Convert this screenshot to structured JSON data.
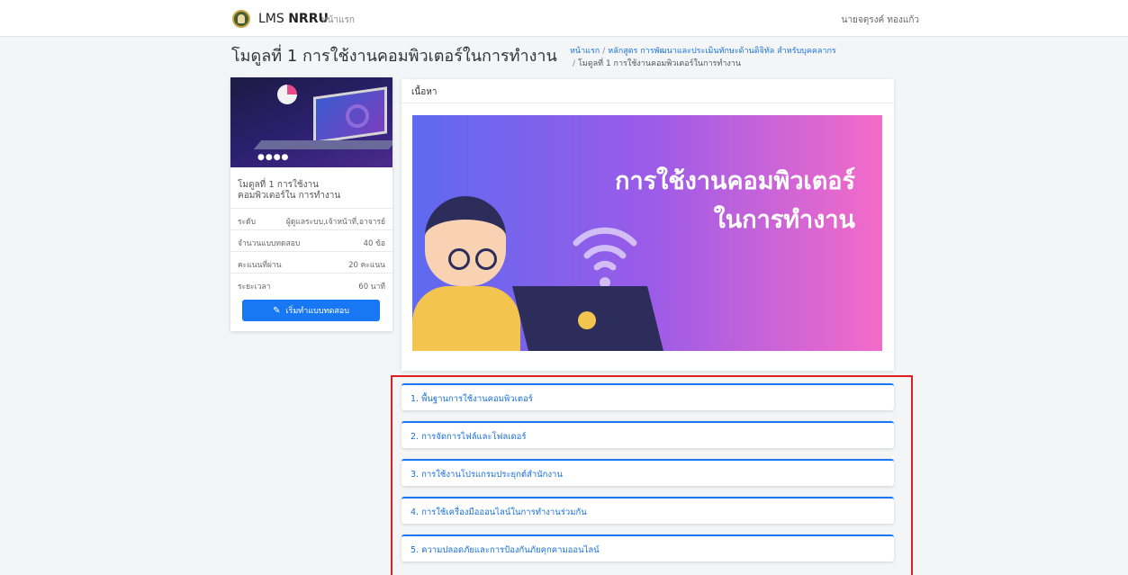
{
  "header": {
    "brand_prefix": "LMS ",
    "brand_bold": "NRRU",
    "nav_home": "หน้าแรก",
    "user_name": "นายจตุรงค์ ทองแก้ว"
  },
  "page": {
    "title": "โมดูลที่ 1 การใช้งานคอมพิวเตอร์ในการทำงาน",
    "breadcrumb": [
      "หน้าแรก",
      "หลักสูตร การพัฒนาและประเมินทักษะด้านดิจิทัล สำหรับบุคคลากร",
      "โมดูลที่ 1 การใช้งานคอมพิวเตอร์ในการทำงาน"
    ],
    "breadcrumb_sep": "/"
  },
  "sidebar": {
    "module_name": "โมดูลที่ 1 การใช้งานคอมพิวเตอร์ใน การทำงาน",
    "cover_social": "●●●●",
    "info": [
      {
        "label": "ระดับ",
        "value": "ผู้ดูแลระบบ,เจ้าหน้าที่,อาจารย์"
      },
      {
        "label": "จำนวนแบบทดสอบ",
        "value": "40 ข้อ"
      },
      {
        "label": "คะแนนที่ผ่าน",
        "value": "20 คะแนน"
      },
      {
        "label": "ระยะเวลา",
        "value": "60 นาที"
      }
    ],
    "start_button": "เริ่มทำแบบทดสอบ",
    "start_icon": "pencil-icon"
  },
  "content": {
    "header": "เนื้อหา",
    "banner_line1": "การใช้งานคอมพิวเตอร์",
    "banner_line2": "ในการทำงาน"
  },
  "lessons": [
    "1. พื้นฐานการใช้งานคอมพิวเตอร์",
    "2. การจัดการไฟล์และโฟลเดอร์",
    "3. การใช้งานโปรแกรมประยุกต์สำนักงาน",
    "4. การใช้เครื่องมือออนไลน์ในการทำงานร่วมกัน",
    "5. ความปลอดภัยและการป้องกันภัยคุกคามออนไลน์"
  ],
  "colors": {
    "accent": "#1877f2",
    "highlight_border": "#e02020",
    "banner_start": "#5e6af0",
    "banner_end": "#f46bc8"
  }
}
